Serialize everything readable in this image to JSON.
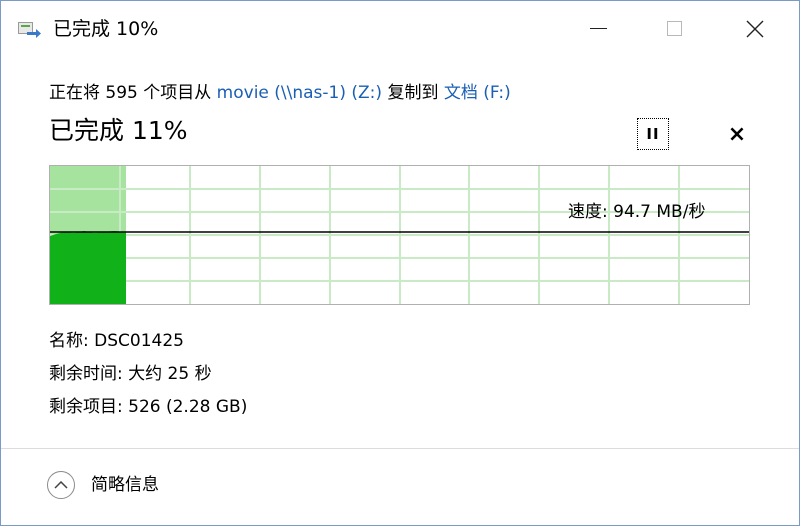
{
  "window": {
    "title": "已完成 10%",
    "icon": "file-copy-icon",
    "controls": {
      "minimize": "minimize-icon",
      "maximize": "maximize-icon",
      "close": "close-icon"
    }
  },
  "copy": {
    "prefix": "正在将 595 个项目从 ",
    "source": "movie (\\\\nas-1) (Z:)",
    "middle": " 复制到 ",
    "destination": "文档 (F:)"
  },
  "progress": {
    "label": "已完成 11%",
    "percent": 11
  },
  "buttons": {
    "pause": "II",
    "stop": "×"
  },
  "graph": {
    "speed_label": "速度: 94.7 MB/秒",
    "colors": {
      "done": "#11b11a",
      "background_done": "#a5e39f",
      "grid": "#c8eac4",
      "speed_line": "#000000"
    }
  },
  "details": {
    "name": "名称: DSC01425",
    "time_left": "剩余时间: 大约 25 秒",
    "items_left": "剩余项目: 526 (2.28 GB)"
  },
  "footer": {
    "less_details": "简略信息",
    "icon": "chevron-up-icon"
  }
}
